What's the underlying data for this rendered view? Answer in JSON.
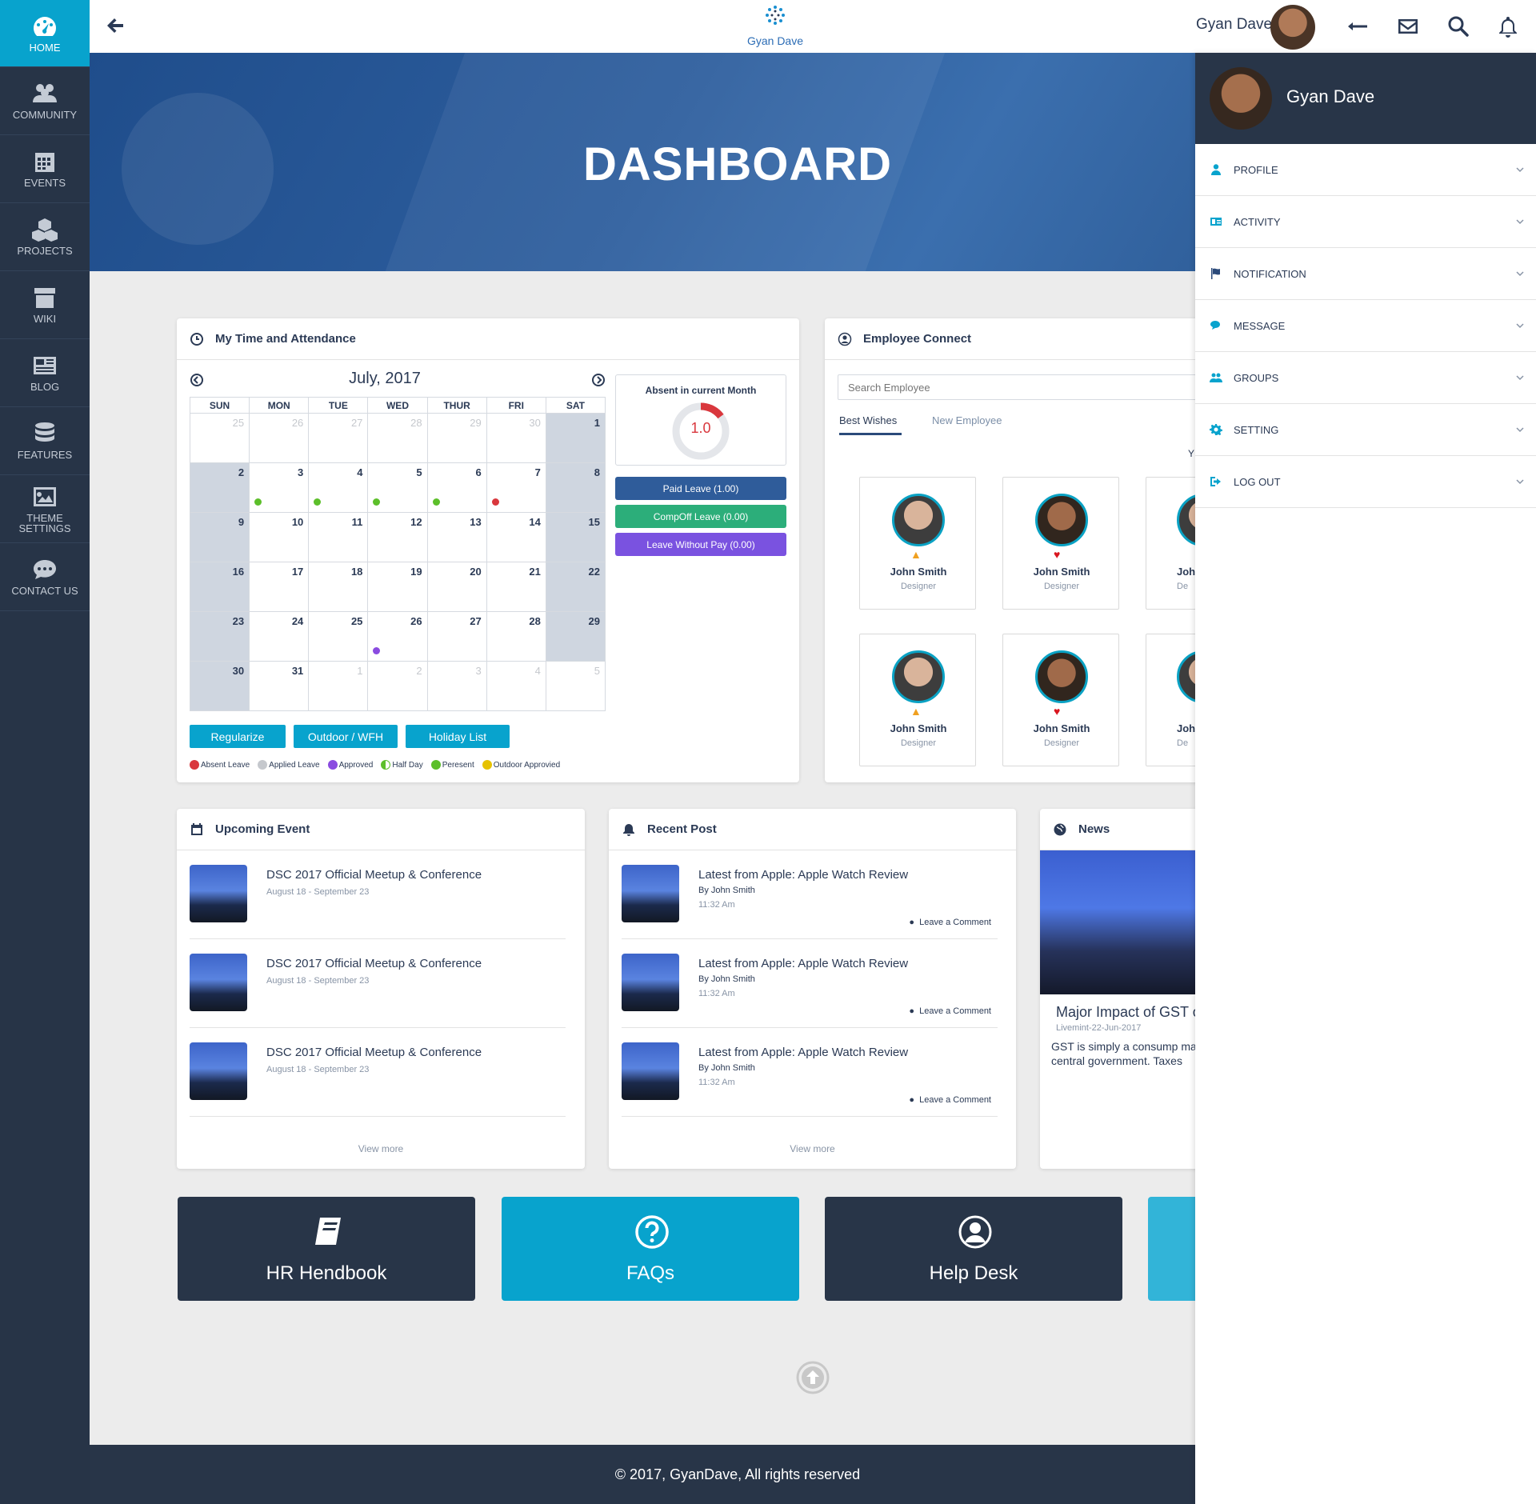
{
  "brand": {
    "name": "Gyan Dave"
  },
  "sidebar": {
    "items": [
      {
        "label": "HOME"
      },
      {
        "label": "COMMUNITY"
      },
      {
        "label": "EVENTS"
      },
      {
        "label": "PROJECTS"
      },
      {
        "label": "WIKI"
      },
      {
        "label": "BLOG"
      },
      {
        "label": "FEATURES"
      },
      {
        "label": "THEME SETTINGS"
      },
      {
        "label": "CONTACT US"
      }
    ]
  },
  "topbar": {
    "user_name": "Gyan Dave"
  },
  "hero": {
    "title": "DASHBOARD"
  },
  "attendance": {
    "title": "My Time and Attendance",
    "month": "July, 2017",
    "days": [
      "SUN",
      "MON",
      "TUE",
      "WED",
      "THUR",
      "FRI",
      "SAT"
    ],
    "absent_label": "Absent in current Month",
    "absent_value": "1.0",
    "paid_leave": "Paid Leave (1.00)",
    "compoff_leave": "CompOff Leave (0.00)",
    "lwp_leave": "Leave Without Pay (0.00)",
    "buttons": {
      "regularize": "Regularize",
      "outdoor": "Outdoor / WFH",
      "holiday": "Holiday List"
    },
    "legend": [
      "Absent Leave",
      "Applied  Leave",
      "Approved",
      "Half Day",
      "Peresent",
      "Outdoor Approvied"
    ],
    "weeks": [
      [
        "25",
        "26",
        "27",
        "28",
        "29",
        "30",
        "1"
      ],
      [
        "2",
        "3",
        "4",
        "5",
        "6",
        "7",
        "8"
      ],
      [
        "9",
        "10",
        "11",
        "12",
        "13",
        "14",
        "15"
      ],
      [
        "16",
        "17",
        "18",
        "19",
        "20",
        "21",
        "22"
      ],
      [
        "23",
        "24",
        "25",
        "26",
        "27",
        "28",
        "29"
      ],
      [
        "30",
        "31",
        "1",
        "2",
        "3",
        "4",
        "5"
      ]
    ],
    "colors": {
      "present": "#5cbf2a",
      "absent": "#d9373d",
      "approved": "#8a4be0",
      "paid": "#2f5c9a",
      "compoff": "#2cae7a",
      "lwp": "#7a52e0"
    }
  },
  "employee_connect": {
    "title": "Employee Connect",
    "search_placeholder": "Search Employee",
    "tabs": [
      "Best Wishes",
      "New Employee"
    ],
    "employees": [
      {
        "name": "John Smith",
        "role": "Designer"
      },
      {
        "name": "John Smith",
        "role": "Designer"
      },
      {
        "name": "John",
        "role": "De"
      },
      {
        "name": "John Smith",
        "role": "Designer"
      },
      {
        "name": "John Smith",
        "role": "Designer"
      },
      {
        "name": "John",
        "role": "De"
      }
    ]
  },
  "upcoming_event": {
    "title": "Upcoming  Event",
    "items": [
      {
        "title": "DSC 2017 Official Meetup & Conference",
        "date": "August 18 - September 23"
      },
      {
        "title": "DSC 2017 Official Meetup & Conference",
        "date": "August 18 - September 23"
      },
      {
        "title": "DSC 2017 Official Meetup & Conference",
        "date": "August 18 - September 23"
      }
    ],
    "view_more": "View more"
  },
  "recent_post": {
    "title": "Recent Post",
    "items": [
      {
        "title": "Latest from Apple: Apple Watch Review",
        "by": "By John Smith",
        "time": "11:32 Am",
        "comment": "Leave a Comment"
      },
      {
        "title": "Latest from Apple: Apple Watch Review",
        "by": "By John Smith",
        "time": "11:32 Am",
        "comment": "Leave a Comment"
      },
      {
        "title": "Latest from Apple: Apple Watch Review",
        "by": "By John Smith",
        "time": "11:32 Am",
        "comment": "Leave a Comment"
      }
    ],
    "view_more": "View more"
  },
  "news": {
    "title": "News",
    "headline": "Major Impact of GST o",
    "date": "Livemint-22-Jun-2017",
    "text": "GST is simply a consump manufacture and consum level. This tax will be a sta central government. Taxes"
  },
  "tiles": [
    {
      "label": "HR Hendbook"
    },
    {
      "label": "FAQs"
    },
    {
      "label": "Help Desk"
    }
  ],
  "footer": {
    "text": "© 2017, GyanDave, All rights reserved"
  },
  "panel": {
    "user_name": "Gyan Dave",
    "items": [
      {
        "label": "PROFILE"
      },
      {
        "label": "ACTIVITY"
      },
      {
        "label": "NOTIFICATION"
      },
      {
        "label": "MESSAGE"
      },
      {
        "label": "GROUPS"
      },
      {
        "label": "SETTING"
      },
      {
        "label": "LOG OUT"
      }
    ]
  }
}
